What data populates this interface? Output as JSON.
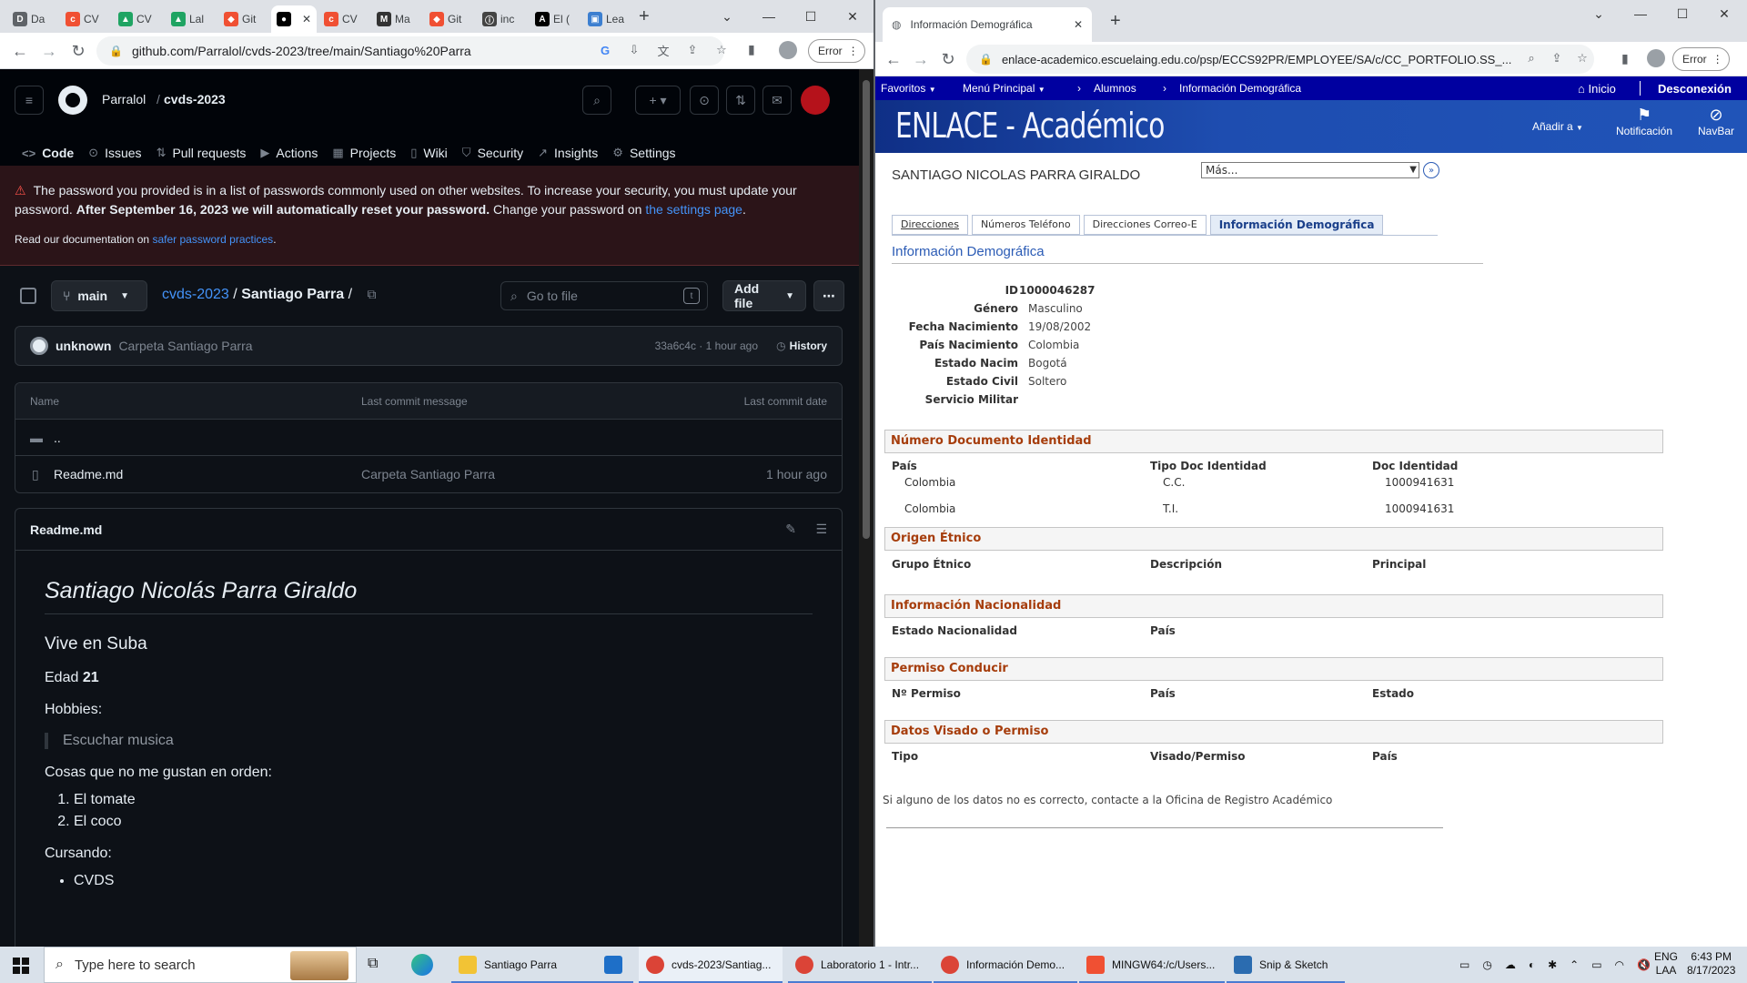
{
  "left_browser": {
    "tabs": [
      {
        "label": "Da",
        "color": "#5f6368",
        "glyph": "D"
      },
      {
        "label": "CV",
        "color": "#f05033",
        "glyph": "c"
      },
      {
        "label": "CV",
        "color": "#1fa463",
        "glyph": "▲"
      },
      {
        "label": "Lal",
        "color": "#1fa463",
        "glyph": "▲"
      },
      {
        "label": "Git",
        "color": "#f05033",
        "glyph": "◆"
      },
      {
        "label": "",
        "color": "#000000",
        "glyph": "●"
      },
      {
        "label": "CV",
        "color": "#f05033",
        "glyph": "c"
      },
      {
        "label": "Ma",
        "color": "#333333",
        "glyph": "M"
      },
      {
        "label": "Git",
        "color": "#f05033",
        "glyph": "◆"
      },
      {
        "label": "inc",
        "color": "#444444",
        "glyph": "ⓘ"
      },
      {
        "label": "El (",
        "color": "#000000",
        "glyph": "A"
      },
      {
        "label": "Lea",
        "color": "#3c7fd0",
        "glyph": "▣"
      }
    ],
    "active_tab_index": 5,
    "url": "github.com/Parralol/cvds-2023/tree/main/Santiago%20Parra",
    "error_label": "Error"
  },
  "github": {
    "owner": "Parralol",
    "separator": "/",
    "repo": "cvds-2023",
    "nav": [
      {
        "label": "Code",
        "icon": "<>",
        "name": "code"
      },
      {
        "label": "Issues",
        "icon": "⊙",
        "name": "issues"
      },
      {
        "label": "Pull requests",
        "icon": "⇅",
        "name": "pull-requests"
      },
      {
        "label": "Actions",
        "icon": "▶",
        "name": "actions"
      },
      {
        "label": "Projects",
        "icon": "▦",
        "name": "projects"
      },
      {
        "label": "Wiki",
        "icon": "▯",
        "name": "wiki"
      },
      {
        "label": "Security",
        "icon": "⛉",
        "name": "security"
      },
      {
        "label": "Insights",
        "icon": "↗",
        "name": "insights"
      },
      {
        "label": "Settings",
        "icon": "⚙",
        "name": "settings"
      }
    ],
    "banner": {
      "text1": "The password you provided is in a list of passwords commonly used on other websites. To increase your security, you must update your password.",
      "bold": "After September 16, 2023 we will automatically reset your password.",
      "text2": "Change your password on",
      "link": "the settings page",
      "end": ".",
      "small_text": "Read our documentation on",
      "small_link": "safer password practices",
      "small_end": "."
    },
    "branch": "main",
    "breadcrumb_repo": "cvds-2023",
    "breadcrumb_folder": "Santiago Parra",
    "breadcrumb_sep": "/",
    "breadcrumb_trail": "/",
    "goto_placeholder": "Go to file",
    "goto_key": "t",
    "add_file": "Add file",
    "commit": {
      "author": "unknown",
      "message": "Carpeta Santiago Parra",
      "sha_time": "33a6c4c · 1 hour ago",
      "history": "History"
    },
    "table": {
      "headers": [
        "Name",
        "Last commit message",
        "Last commit date"
      ],
      "rows": [
        {
          "name": "..",
          "message": "",
          "date": "",
          "type": "folder"
        },
        {
          "name": "Readme.md",
          "message": "Carpeta Santiago Parra",
          "date": "1 hour ago",
          "type": "file"
        }
      ]
    },
    "readme": {
      "filename": "Readme.md",
      "h1": "Santiago Nicolás Parra Giraldo",
      "h2": "Vive en Suba",
      "age_label": "Edad",
      "age_value": "21",
      "hobbies_label": "Hobbies:",
      "hobby": "Escuchar musica",
      "dislikes_label": "Cosas que no me gustan en orden:",
      "dislikes": [
        "El tomate",
        "El coco"
      ],
      "courses_label": "Cursando:",
      "courses": [
        "CVDS"
      ]
    }
  },
  "right_browser": {
    "tab_title": "Información Demográfica",
    "url": "enlace-academico.escuelaing.edu.co/psp/ECCS92PR/EMPLOYEE/SA/c/CC_PORTFOLIO.SS_...",
    "error_label": "Error"
  },
  "enlace": {
    "menu": {
      "favoritos": "Favoritos",
      "menu_principal": "Menú Principal",
      "alumnos": "Alumnos",
      "info_demo": "Información Demográfica",
      "inicio": "Inicio",
      "desconexion": "Desconexión"
    },
    "logo": "ENLACE - Académico",
    "anadir": "Añadir a",
    "notificacion": "Notificación",
    "navbar": "NavBar",
    "person_name": "SANTIAGO NICOLAS PARRA GIRALDO",
    "mas_select": "Más...",
    "tabs": [
      "Direcciones",
      "Números Teléfono",
      "Direcciones Correo-E",
      "Información Demográfica"
    ],
    "section_title": "Información Demográfica",
    "fields": [
      {
        "label": "ID",
        "value": "1000046287"
      },
      {
        "label": "Género",
        "value": "Masculino"
      },
      {
        "label": "Fecha Nacimiento",
        "value": "19/08/2002"
      },
      {
        "label": "País Nacimiento",
        "value": "Colombia"
      },
      {
        "label": "Estado Nacim",
        "value": "Bogotá"
      },
      {
        "label": "Estado Civil",
        "value": "Soltero"
      },
      {
        "label": "Servicio Militar",
        "value": ""
      }
    ],
    "doc_section": {
      "title": "Número Documento Identidad",
      "headers": [
        "País",
        "Tipo Doc Identidad",
        "Doc Identidad"
      ],
      "rows": [
        [
          "Colombia",
          "C.C.",
          "1000941631"
        ],
        [
          "Colombia",
          "T.I.",
          "1000941631"
        ]
      ]
    },
    "etnico_section": {
      "title": "Origen Étnico",
      "headers": [
        "Grupo Étnico",
        "Descripción",
        "Principal"
      ]
    },
    "nacionalidad_section": {
      "title": "Información Nacionalidad",
      "headers": [
        "Estado Nacionalidad",
        "País"
      ]
    },
    "conducir_section": {
      "title": "Permiso Conducir",
      "headers": [
        "Nº Permiso",
        "País",
        "Estado"
      ]
    },
    "visado_section": {
      "title": "Datos Visado o Permiso",
      "headers": [
        "Tipo",
        "Visado/Permiso",
        "País"
      ]
    },
    "footer_text": "Si alguno de los datos no es correcto, contacte a la Oficina de Registro Académico"
  },
  "taskbar": {
    "search_placeholder": "Type here to search",
    "apps": [
      {
        "label": "Santiago Parra",
        "name": "file-explorer",
        "color": "#f2c335"
      },
      {
        "label": "",
        "name": "mail",
        "color": "#1e6fc8"
      },
      {
        "label": "cvds-2023/Santiag...",
        "name": "chrome-cvds",
        "color": "#db4437"
      },
      {
        "label": "Laboratorio 1 - Intr...",
        "name": "chrome-lab",
        "color": "#db4437"
      },
      {
        "label": "Información Demo...",
        "name": "chrome-enlace",
        "color": "#db4437"
      },
      {
        "label": "MINGW64:/c/Users...",
        "name": "git-bash",
        "color": "#f05033"
      },
      {
        "label": "Snip & Sketch",
        "name": "snip-sketch",
        "color": "#2b6cb0"
      }
    ],
    "lang1": "ENG",
    "lang2": "LAA",
    "time": "6:43 PM",
    "date": "8/17/2023"
  }
}
